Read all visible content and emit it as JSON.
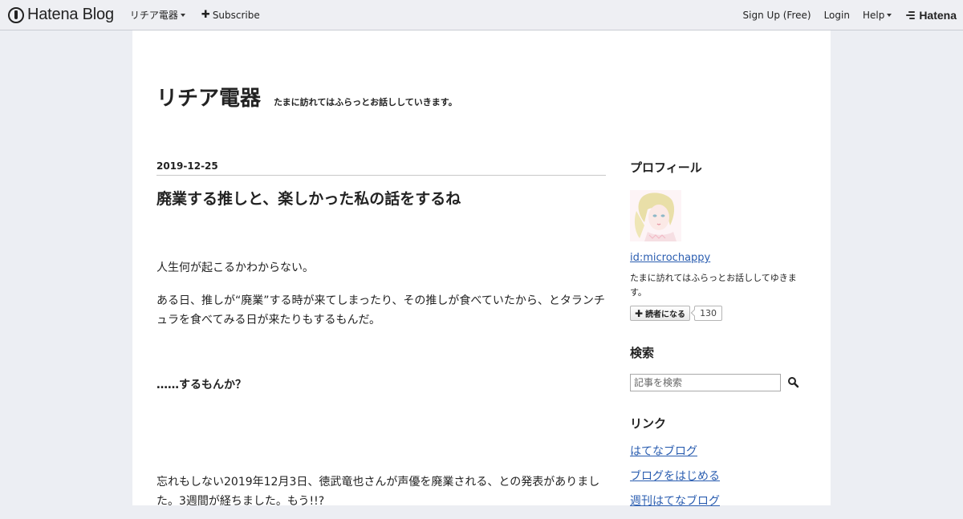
{
  "topbar": {
    "brand": "Hatena Blog",
    "blog_menu": "リチア電器",
    "subscribe": "Subscribe",
    "signup": "Sign Up (Free)",
    "login": "Login",
    "help": "Help",
    "hatena": "Hatena"
  },
  "header": {
    "title": "リチア電器",
    "description": "たまに訪れてはふらっとお話ししていきます。"
  },
  "article": {
    "date": "2019-12-25",
    "title": "廃業する推しと、楽しかった私の話をするね",
    "paragraphs": [
      "人生何が起こるかわからない。",
      "ある日、推しが“廃業”する時が来てしまったり、その推しが食べていたから、とタランチュラを食べてみる日が来たりもするもんだ。",
      "……するもんか？",
      "忘れもしない2019年12月3日、徳武竜也さんが声優を廃業される、との発表がありました。3週間が経ちました。もう!!?"
    ]
  },
  "sidebar": {
    "profile": {
      "title": "プロフィール",
      "id": "id:microchappy",
      "description": "たまに訪れてはふらっとお話ししてゆきます。",
      "subscribe_label": "読者になる",
      "subscriber_count": "130"
    },
    "search": {
      "title": "検索",
      "placeholder": "記事を検索"
    },
    "links": {
      "title": "リンク",
      "items": [
        "はてなブログ",
        "ブログをはじめる",
        "週刊はてなブログ"
      ]
    }
  },
  "colors": {
    "link": "#2a5db0",
    "page_background": "#eceef3",
    "topbar_background": "#eeeff3"
  }
}
